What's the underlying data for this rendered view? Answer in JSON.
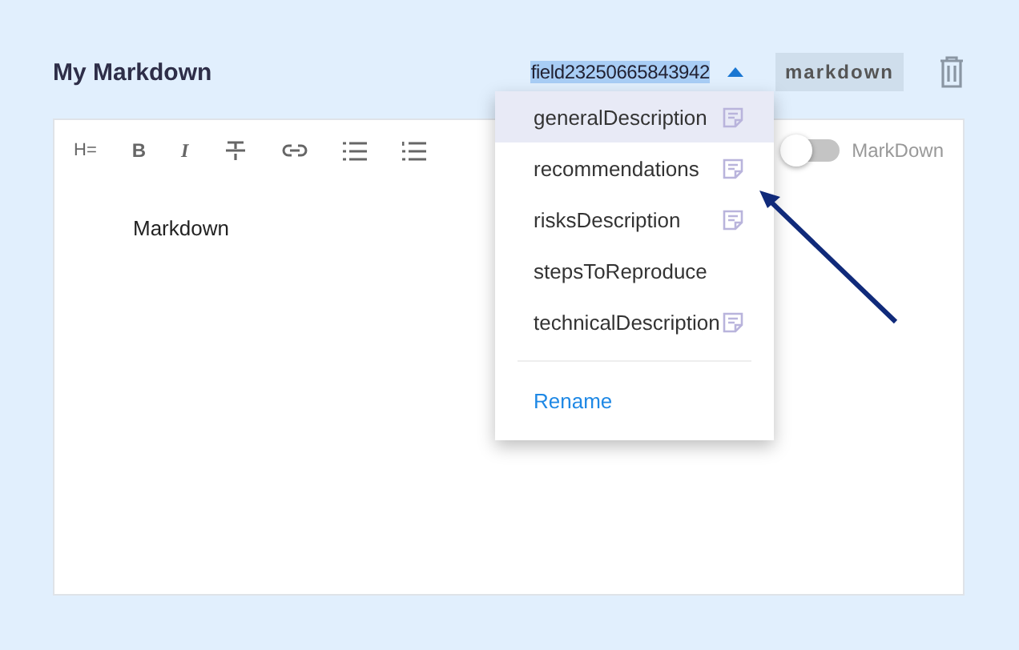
{
  "title": "My Markdown",
  "field": {
    "value": "field23250665843942",
    "expanded": true
  },
  "type_badge": "markdown",
  "toolbar": [
    {
      "kind": "text",
      "glyph": "H="
    },
    {
      "kind": "bold",
      "glyph": "B"
    },
    {
      "kind": "italic",
      "glyph": "I"
    },
    {
      "kind": "strike"
    },
    {
      "kind": "link"
    },
    {
      "kind": "bullets"
    },
    {
      "kind": "numbers"
    }
  ],
  "mode_toggle": {
    "label": "MarkDown",
    "on": false
  },
  "editor_text": "Markdown",
  "menu": {
    "items": [
      {
        "label": "generalDescription",
        "selected": true,
        "has_note": true
      },
      {
        "label": "recommendations",
        "selected": false,
        "has_note": true
      },
      {
        "label": "risksDescription",
        "selected": false,
        "has_note": true
      },
      {
        "label": "stepsToReproduce",
        "selected": false,
        "has_note": false
      },
      {
        "label": "technicalDescription",
        "selected": false,
        "has_note": true
      }
    ],
    "action": "Rename"
  }
}
